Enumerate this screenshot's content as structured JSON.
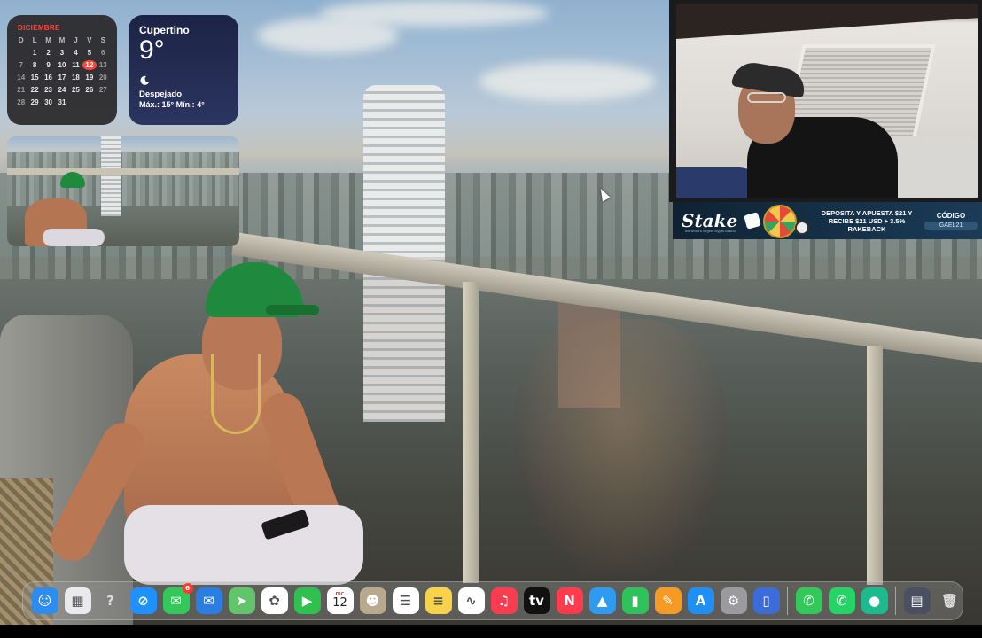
{
  "calendar_widget": {
    "month": "DICIEMBRE",
    "weekdays": [
      "D",
      "L",
      "M",
      "M",
      "J",
      "V",
      "S"
    ],
    "weeks": [
      [
        "",
        "1",
        "2",
        "3",
        "4",
        "5",
        "6"
      ],
      [
        "7",
        "8",
        "9",
        "10",
        "11",
        "12",
        "13"
      ],
      [
        "14",
        "15",
        "16",
        "17",
        "18",
        "19",
        "20"
      ],
      [
        "21",
        "22",
        "23",
        "24",
        "25",
        "26",
        "27"
      ],
      [
        "28",
        "29",
        "30",
        "31",
        "",
        "",
        ""
      ]
    ],
    "today": "12",
    "accent_color": "#ff453a"
  },
  "weather_widget": {
    "city": "Cupertino",
    "temperature": "9°",
    "condition_icon": "moon-icon",
    "condition": "Despejado",
    "range": "Máx.: 15° Mín.: 4°"
  },
  "webcam": {
    "icon": "webcam-feed"
  },
  "stake_banner": {
    "logo": "Stake",
    "tagline": "the world's largest crypto casino",
    "promo_line1": "DEPOSITA Y APUESTA $21 Y",
    "promo_line2": "RECIBE $21 USD + 3.5%",
    "promo_line3": "RAKEBACK",
    "code_label": "CÓDIGO",
    "code_value": "GAEL21"
  },
  "dock": {
    "apps": [
      {
        "name": "finder-icon",
        "glyph": "☺",
        "color": "#2d8cf0"
      },
      {
        "name": "launchpad-icon",
        "glyph": "▦",
        "color": "#e9e9ee"
      },
      {
        "name": "help-icon",
        "glyph": "?",
        "color": "transparent"
      },
      {
        "name": "safari-icon",
        "glyph": "⊘",
        "color": "#1e90ff"
      },
      {
        "name": "messages-icon",
        "glyph": "✉",
        "color": "#34c759",
        "badge": "6"
      },
      {
        "name": "mail-icon",
        "glyph": "✉",
        "color": "#2a7de1"
      },
      {
        "name": "maps-icon",
        "glyph": "➤",
        "color": "#63c56b"
      },
      {
        "name": "photos-icon",
        "glyph": "✿",
        "color": "#ffffff"
      },
      {
        "name": "facetime-icon",
        "glyph": "▶",
        "color": "#30c04f"
      },
      {
        "name": "calendar-icon",
        "glyph": "12",
        "color": "#ffffff",
        "dow": "DIC"
      },
      {
        "name": "contacts-icon",
        "glyph": "☻",
        "color": "#b8a88e"
      },
      {
        "name": "reminders-icon",
        "glyph": "☰",
        "color": "#ffffff"
      },
      {
        "name": "notes-icon",
        "glyph": "≡",
        "color": "#f7d24a"
      },
      {
        "name": "freeform-icon",
        "glyph": "∿",
        "color": "#ffffff"
      },
      {
        "name": "music-icon",
        "glyph": "♫",
        "color": "#fa3c50"
      },
      {
        "name": "apple-tv-icon",
        "glyph": "tv",
        "color": "#111111"
      },
      {
        "name": "news-icon",
        "glyph": "N",
        "color": "#ff3b4e"
      },
      {
        "name": "keynote-icon",
        "glyph": "▲",
        "color": "#2e9bf0"
      },
      {
        "name": "numbers-icon",
        "glyph": "▮",
        "color": "#2fc25b"
      },
      {
        "name": "pages-icon",
        "glyph": "✎",
        "color": "#f59a23"
      },
      {
        "name": "app-store-icon",
        "glyph": "A",
        "color": "#1f8ff5"
      },
      {
        "name": "system-settings-icon",
        "glyph": "⚙",
        "color": "#9a9a9f"
      },
      {
        "name": "simulator-icon",
        "glyph": "▯",
        "color": "#3b6cd8"
      }
    ],
    "recent_apps": [
      {
        "name": "phone-icon",
        "glyph": "✆",
        "color": "#34c759"
      },
      {
        "name": "whatsapp-icon",
        "glyph": "✆",
        "color": "#25d366"
      },
      {
        "name": "obs-icon",
        "glyph": "●",
        "color": "#1db98f"
      }
    ],
    "trailing": [
      {
        "name": "downloads-stack-icon",
        "glyph": "▤",
        "color": "#4a5060"
      },
      {
        "name": "trash-icon",
        "glyph": "🗑",
        "color": "transparent"
      }
    ]
  }
}
